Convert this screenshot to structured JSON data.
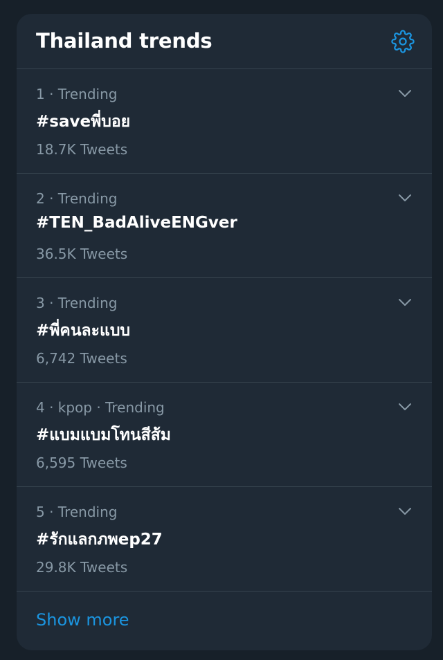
{
  "panel": {
    "title": "Thailand trends",
    "settings_icon": "gear-icon",
    "accent_color": "#1b95e0"
  },
  "trends": [
    {
      "position": "1",
      "context": "",
      "label": "Trending",
      "meta": "1 · Trending",
      "name": "#saveพี่บอย",
      "tweets": "18.7K Tweets"
    },
    {
      "position": "2",
      "context": "",
      "label": "Trending",
      "meta": "2 · Trending",
      "name": "#TEN_BadAliveENGver",
      "tweets": "36.5K Tweets"
    },
    {
      "position": "3",
      "context": "",
      "label": "Trending",
      "meta": "3 · Trending",
      "name": "#พี่คนละแบบ",
      "tweets": "6,742 Tweets"
    },
    {
      "position": "4",
      "context": "kpop",
      "label": "Trending",
      "meta": "4 · kpop · Trending",
      "name": "#แบมแบมโทนสีส้ม",
      "tweets": "6,595 Tweets"
    },
    {
      "position": "5",
      "context": "",
      "label": "Trending",
      "meta": "5 · Trending",
      "name": "#รักแลกภพep27",
      "tweets": "29.8K Tweets"
    }
  ],
  "footer": {
    "show_more_label": "Show more"
  }
}
